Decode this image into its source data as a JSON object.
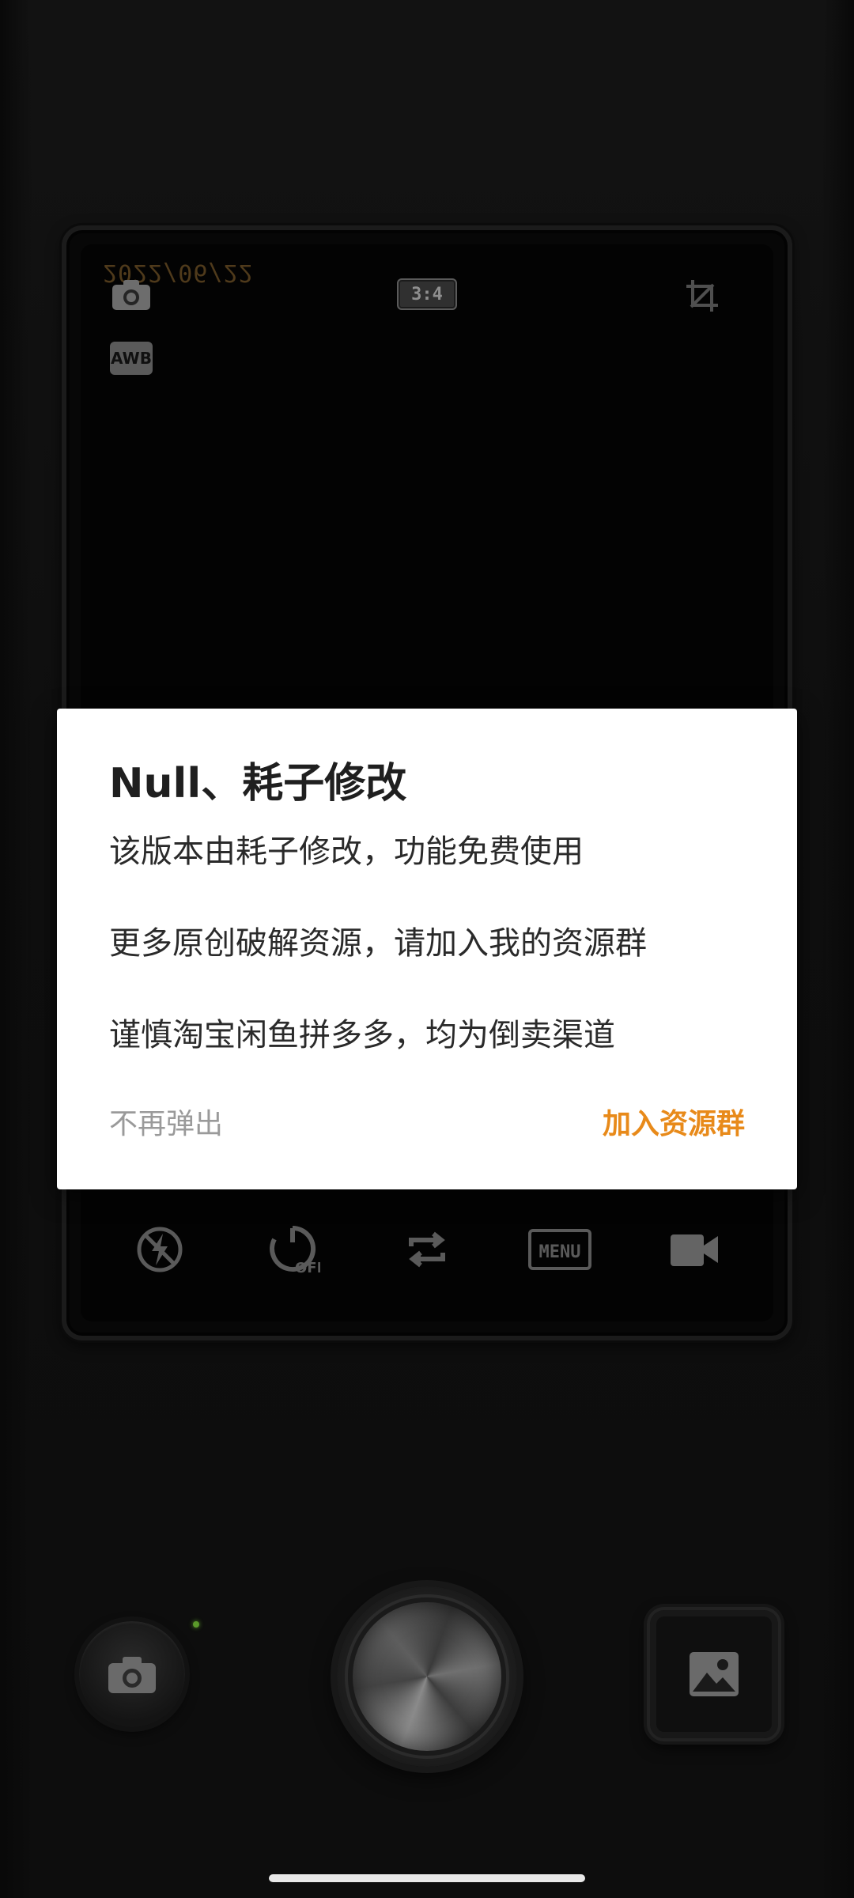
{
  "viewfinder": {
    "date_stamp": "2022/06/22",
    "aspect_ratio": "3:4",
    "white_balance": "AWB",
    "menu_label": "MENU",
    "timer_label": "OFF"
  },
  "dialog": {
    "title": "Null、耗子修改",
    "lines": [
      "该版本由耗子修改，功能免费使用",
      "更多原创破解资源，请加入我的资源群",
      "谨慎淘宝闲鱼拼多多，均为倒卖渠道"
    ],
    "dismiss_label": "不再弹出",
    "join_label": "加入资源群"
  },
  "colors": {
    "accent": "#e88a1a",
    "dismiss": "#9a9a9a"
  },
  "icons": {
    "top": [
      "camera-icon",
      "aspect-ratio-icon",
      "crop-icon"
    ],
    "controls": [
      "flash-off-icon",
      "timer-off-icon",
      "switch-icon",
      "menu-icon",
      "video-icon"
    ],
    "bottom": [
      "camera-icon",
      "shutter",
      "gallery-icon"
    ]
  }
}
